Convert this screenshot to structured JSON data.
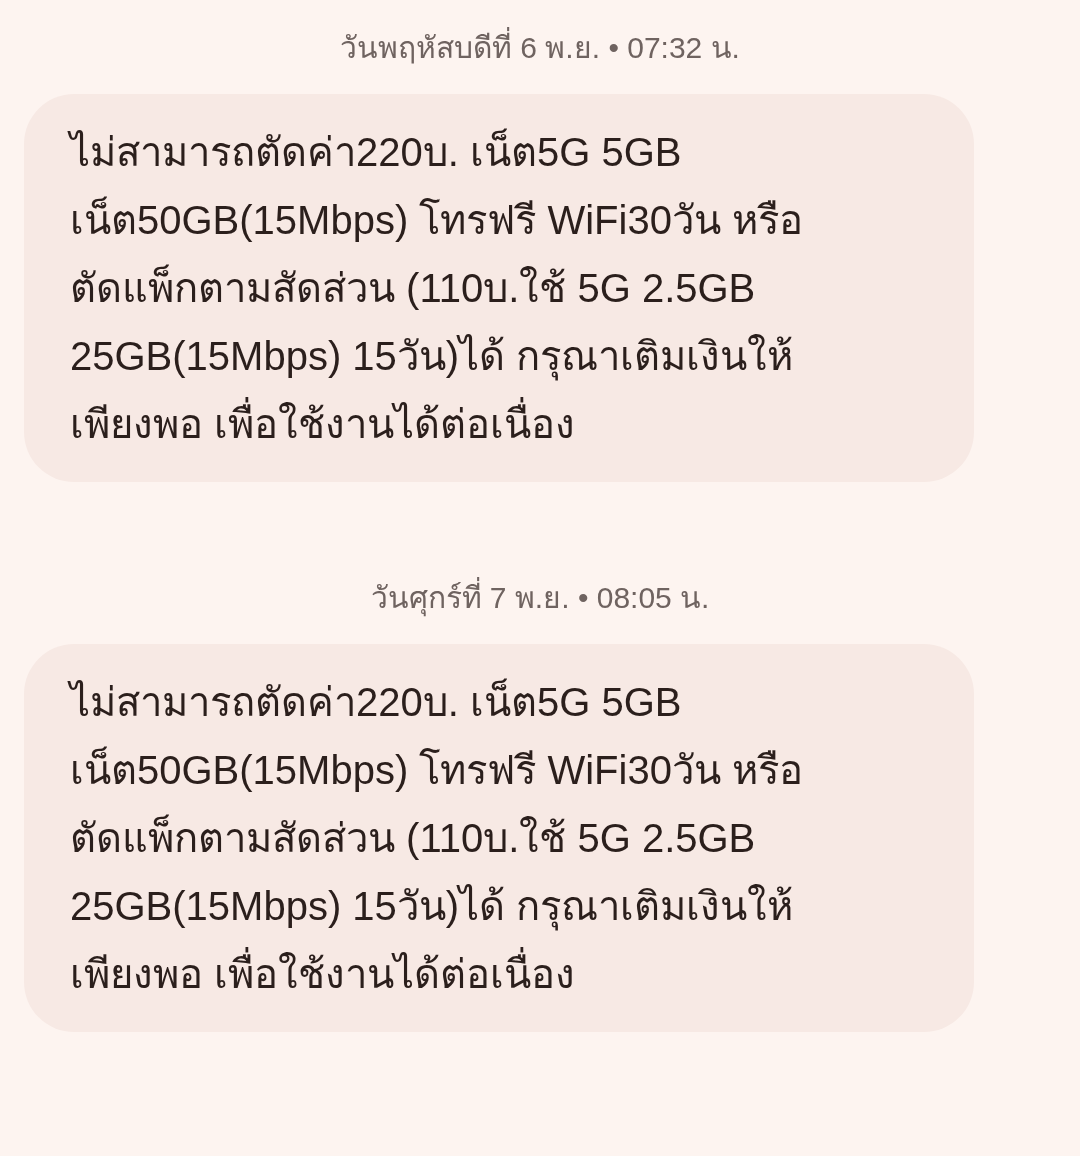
{
  "messages": [
    {
      "timestamp": "วันพฤหัสบดีที่ 6 พ.ย. • 07:32 น.",
      "text": "ไม่สามารถตัดค่า220บ. เน็ต5G 5GB\nเน็ต50GB(15Mbps) โทรฟรี WiFi30วัน หรือ\nตัดแพ็กตามสัดส่วน (110บ.ใช้ 5G 2.5GB\n25GB(15Mbps) 15วัน)ได้ กรุณาเติมเงินให้\nเพียงพอ เพื่อใช้งานได้ต่อเนื่อง"
    },
    {
      "timestamp": "วันศุกร์ที่ 7 พ.ย. • 08:05 น.",
      "text": "ไม่สามารถตัดค่า220บ. เน็ต5G 5GB\nเน็ต50GB(15Mbps) โทรฟรี WiFi30วัน หรือ\nตัดแพ็กตามสัดส่วน (110บ.ใช้ 5G 2.5GB\n25GB(15Mbps) 15วัน)ได้ กรุณาเติมเงินให้\nเพียงพอ เพื่อใช้งานได้ต่อเนื่อง"
    }
  ]
}
